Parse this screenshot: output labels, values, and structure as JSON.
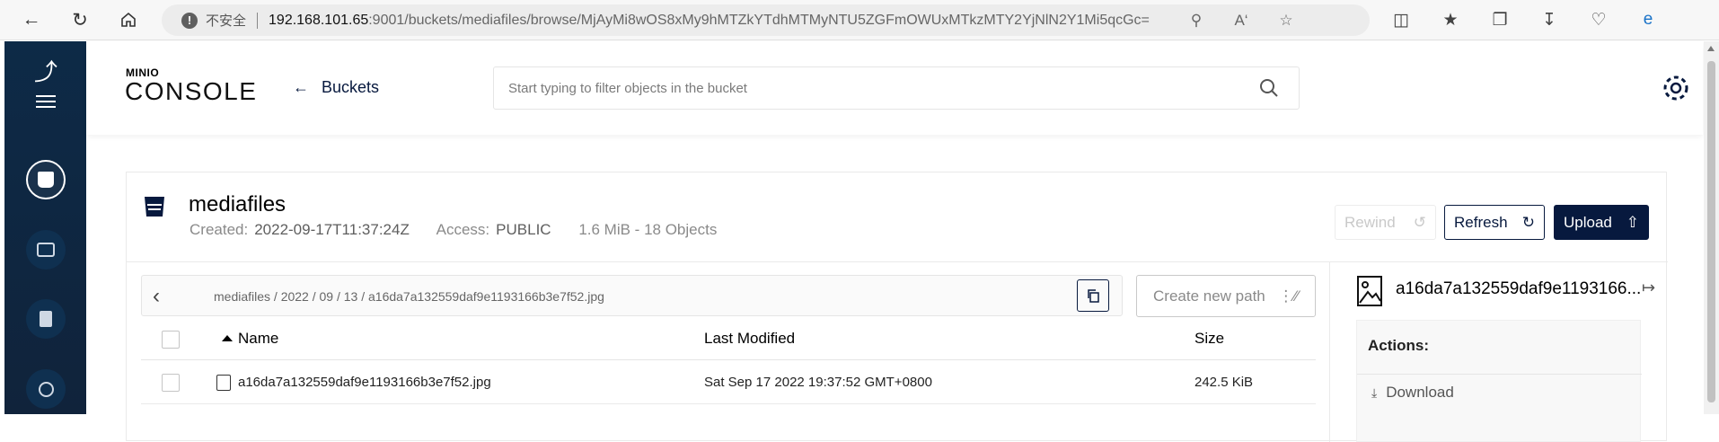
{
  "browser": {
    "insecure_label": "不安全",
    "url_host": "192.168.101.65",
    "url_rest": ":9001/buckets/mediafiles/browse/MjAyMi8wOS8xMy9hMTZkYTdhMTMyNTU5ZGFmOWUxMTkzMTY2YjNlN2Y1Mi5qcGc="
  },
  "logo": {
    "small": "MINIO",
    "big": "CONSOLE"
  },
  "header": {
    "back_label": "Buckets",
    "search_placeholder": "Start typing to filter objects in the bucket"
  },
  "bucket": {
    "name": "mediafiles",
    "created_label": "Created:",
    "created_value": "2022-09-17T11:37:24Z",
    "access_label": "Access:",
    "access_value": "PUBLIC",
    "size_info": "1.6 MiB - 18 Objects"
  },
  "buttons": {
    "rewind": "Rewind",
    "refresh": "Refresh",
    "upload": "Upload",
    "create_new_path": "Create new path"
  },
  "breadcrumb": {
    "path": "mediafiles  /  2022  /  09  /  13  /  a16da7a132559daf9e1193166b3e7f52.jpg"
  },
  "table": {
    "columns": [
      "Name",
      "Last Modified",
      "Size"
    ],
    "rows": [
      {
        "name": "a16da7a132559daf9e1193166b3e7f52.jpg",
        "modified": "Sat Sep 17 2022 19:37:52 GMT+0800",
        "size": "242.5 KiB"
      }
    ]
  },
  "panel": {
    "object_name": "a16da7a132559daf9e1193166...",
    "actions_title": "Actions:",
    "download_label": "Download"
  },
  "colors": {
    "sidebar_bg": "#0d2a47",
    "primary": "#07193e",
    "border": "#e5e5e5"
  },
  "icons": [
    "back-arrow-icon",
    "forward-arrow-icon",
    "reload-icon",
    "home-icon",
    "warning-icon",
    "key-icon",
    "read-aloud-icon",
    "favorite-icon",
    "split-screen-icon",
    "favorites-list-icon",
    "collections-icon",
    "downloads-icon",
    "health-icon",
    "edge-icon",
    "search-icon",
    "gear-icon",
    "bucket-icon",
    "rewind-icon",
    "refresh-icon",
    "upload-icon",
    "copy-icon",
    "new-path-icon",
    "image-file-icon",
    "close-panel-icon",
    "download-icon"
  ]
}
